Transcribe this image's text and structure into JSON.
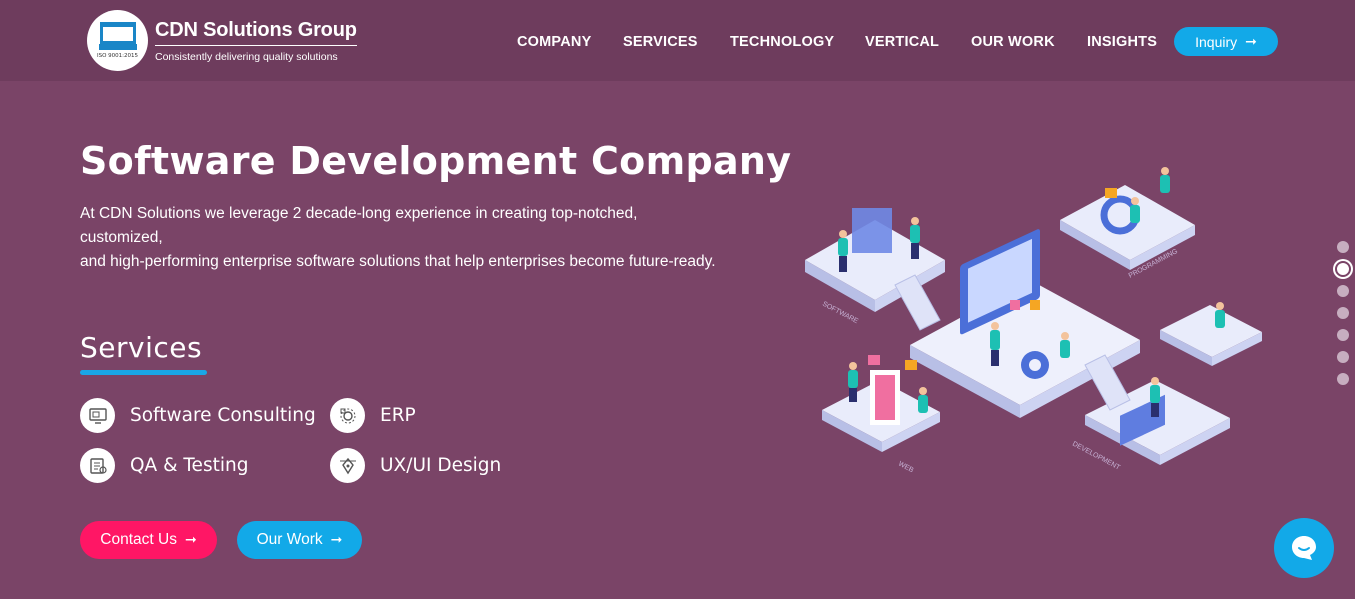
{
  "header": {
    "logo": {
      "badge_text": "ISO 9001:2015",
      "title": "CDN Solutions Group",
      "tagline": "Consistently delivering quality solutions"
    },
    "nav": [
      {
        "label": "COMPANY"
      },
      {
        "label": "SERVICES"
      },
      {
        "label": "TECHNOLOGY"
      },
      {
        "label": "VERTICAL"
      },
      {
        "label": "OUR WORK"
      },
      {
        "label": "INSIGHTS"
      }
    ],
    "inquiry_label": "Inquiry"
  },
  "hero": {
    "title": "Software Development Company",
    "description_1": "At CDN Solutions we leverage 2 decade-long experience in creating top-notched, customized,",
    "description_2": "and high-performing enterprise software solutions that help enterprises become future-ready."
  },
  "services": {
    "title": "Services",
    "items": [
      {
        "label": "Software Consulting",
        "icon": "monitor-icon"
      },
      {
        "label": "ERP",
        "icon": "erp-gears-icon"
      },
      {
        "label": "QA & Testing",
        "icon": "checklist-icon"
      },
      {
        "label": "UX/UI Design",
        "icon": "design-pen-icon"
      }
    ]
  },
  "buttons": {
    "contact_label": "Contact Us",
    "work_label": "Our Work"
  },
  "illustration": {
    "labels": [
      "SOFTWARE",
      "PROGRAMMING",
      "WEB",
      "DEVELOPMENT"
    ]
  },
  "pagination": {
    "count": 7,
    "active_index": 1
  },
  "colors": {
    "background": "#7a4467",
    "header": "#6e3c5d",
    "accent_blue": "#12a9e8",
    "accent_pink": "#ff1665"
  }
}
